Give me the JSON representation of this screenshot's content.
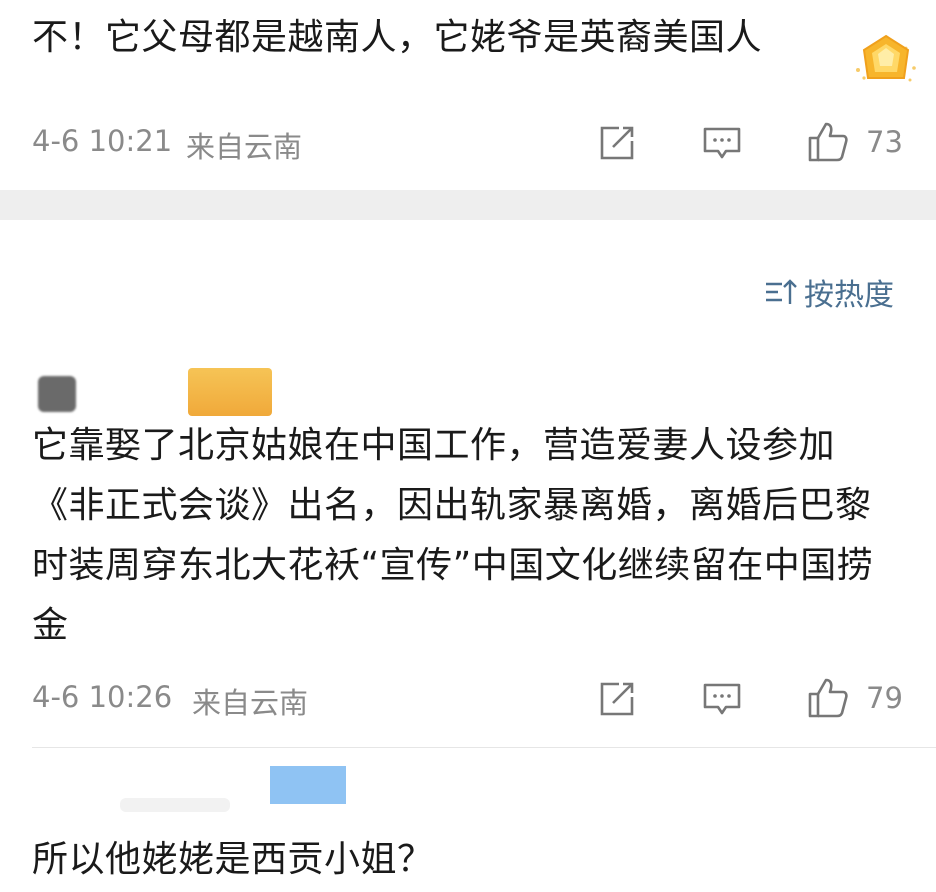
{
  "comments": [
    {
      "text": "不！它父母都是越南人，它姥爷是英裔美国人",
      "time": "4-6 10:21",
      "location": "来自云南",
      "likes": "73"
    },
    {
      "text": "它靠娶了北京姑娘在中国工作，营造爱妻人设参加《非正式会谈》出名，因出轨家暴离婚，离婚后巴黎时装周穿东北大花袄“宣传”中国文化继续留在中国捞金",
      "time": "4-6 10:26",
      "location": "来自云南",
      "likes": "79"
    },
    {
      "text": "所以他姥姥是西贡小姐？"
    }
  ],
  "sort": {
    "label": "按热度"
  },
  "colors": {
    "accent": "#4a6f90",
    "meta": "#8a8a8a",
    "badge": "#f5b942"
  },
  "icons": [
    "medal-icon",
    "share-icon",
    "reply-icon",
    "like-icon",
    "sort-icon"
  ]
}
